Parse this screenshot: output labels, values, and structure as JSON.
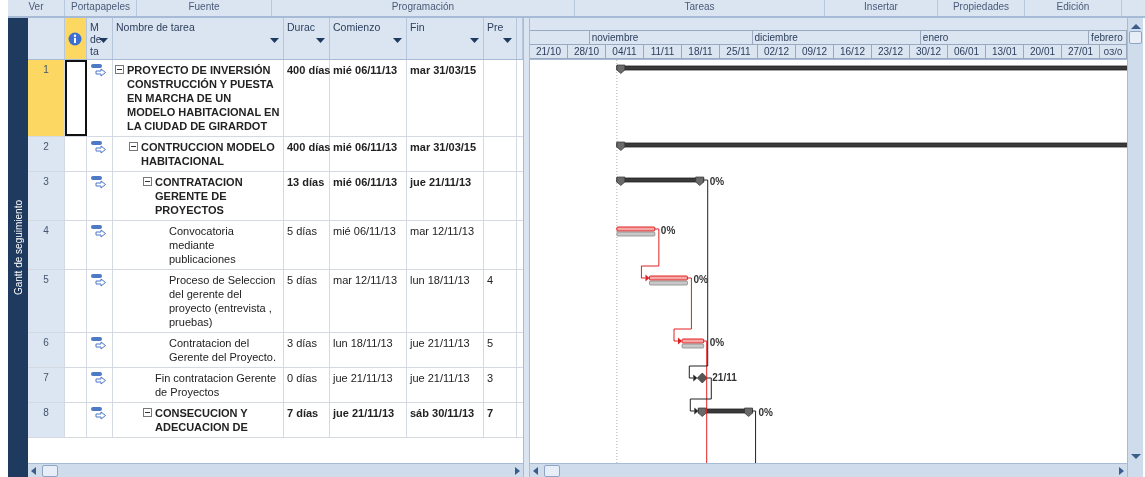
{
  "ribbon_groups": [
    {
      "label": "Ver"
    },
    {
      "label": "Portapapeles"
    },
    {
      "label": "Fuente"
    },
    {
      "label": "Programación"
    },
    {
      "label": "Tareas"
    },
    {
      "label": "Insertar"
    },
    {
      "label": "Propiedades"
    },
    {
      "label": "Edición"
    }
  ],
  "side_label": "Gantt de seguimiento",
  "table": {
    "columns": [
      {
        "kind": "indicators",
        "selected": true
      },
      {
        "kind": "mode",
        "label": "M de ta",
        "selected": false
      },
      {
        "kind": "name",
        "label": "Nombre de tarea",
        "selected": false
      },
      {
        "kind": "duration",
        "label": "Durac",
        "selected": false
      },
      {
        "kind": "start",
        "label": "Comienzo",
        "selected": false
      },
      {
        "kind": "finish",
        "label": "Fin",
        "selected": false
      },
      {
        "kind": "predecessors",
        "label": "Pre",
        "selected": false
      }
    ],
    "rows": [
      {
        "number": "1",
        "name": "PROYECTO DE INVERSIÓN CONSTRUCCIÓN Y PUESTA EN MARCHA DE UN MODELO HABITACIONAL EN LA CIUDAD DE GIRARDOT",
        "summary": true,
        "expanded": true,
        "selected": true,
        "duration": "400 días",
        "start": "mié 06/11/13",
        "finish": "mar 31/03/15",
        "bar": {
          "kind": "summary",
          "critical": false
        },
        "children": [
          {
            "number": "2",
            "name": "CONTRUCCION MODELO HABITACIONAL",
            "summary": true,
            "expanded": true,
            "selected": false,
            "duration": "400 días",
            "start": "mié 06/11/13",
            "finish": "mar 31/03/15",
            "bar": {
              "kind": "summary",
              "critical": false
            },
            "children": [
              {
                "number": "3",
                "name": "CONTRATACION GERENTE DE PROYECTOS",
                "summary": true,
                "expanded": true,
                "selected": false,
                "duration": "13 días",
                "start": "mié 06/11/13",
                "finish": "jue 21/11/13",
                "bar": {
                  "kind": "summary",
                  "critical": false,
                  "label": "0%"
                },
                "children": [
                  {
                    "number": "4",
                    "name": "Convocatoria mediante publicaciones",
                    "summary": false,
                    "selected": false,
                    "duration": "5 días",
                    "start": "mié 06/11/13",
                    "finish": "mar 12/11/13",
                    "bar": {
                      "kind": "task",
                      "critical": true,
                      "label": "0%"
                    }
                  },
                  {
                    "number": "5",
                    "name": "Proceso de Seleccion del gerente del proyecto (entrevista , pruebas)",
                    "summary": false,
                    "selected": false,
                    "duration": "5 días",
                    "start": "mar 12/11/13",
                    "finish": "lun 18/11/13",
                    "predecessors": "4",
                    "bar": {
                      "kind": "task",
                      "critical": true,
                      "label": "0%"
                    }
                  },
                  {
                    "number": "6",
                    "name": "Contratacion del Gerente del Proyecto.",
                    "summary": false,
                    "selected": false,
                    "duration": "3 días",
                    "start": "lun 18/11/13",
                    "finish": "jue 21/11/13",
                    "predecessors": "5",
                    "link_below": true,
                    "bar": {
                      "kind": "task",
                      "critical": true,
                      "label": "0%"
                    }
                  }
                ]
              },
              {
                "number": "7",
                "name": "Fin contratacion Gerente de Proyectos",
                "summary": false,
                "selected": false,
                "duration": "0 días",
                "start": "jue 21/11/13",
                "finish": "jue 21/11/13",
                "predecessors": "3",
                "bar": {
                  "kind": "milestone",
                  "critical": false,
                  "label": "21/11"
                }
              },
              {
                "number": "8",
                "name": "CONSECUCION Y ADECUACION DE",
                "summary": true,
                "expanded": true,
                "selected": false,
                "duration": "7 días",
                "start": "jue 21/11/13",
                "finish": "sáb 30/11/13",
                "predecessors": "7",
                "link_below": true,
                "bar": {
                  "kind": "summary",
                  "critical": false,
                  "label": "0%"
                }
              }
            ]
          }
        ]
      }
    ]
  },
  "gantt": {
    "months": [
      "noviembre",
      "diciembre",
      "enero",
      "febrero"
    ],
    "weeks": [
      "21/10",
      "28/10",
      "04/11",
      "11/11",
      "18/11",
      "25/11",
      "02/12",
      "09/12",
      "16/12",
      "23/12",
      "30/12",
      "06/01",
      "13/01",
      "20/01",
      "27/01",
      "03/0"
    ]
  }
}
